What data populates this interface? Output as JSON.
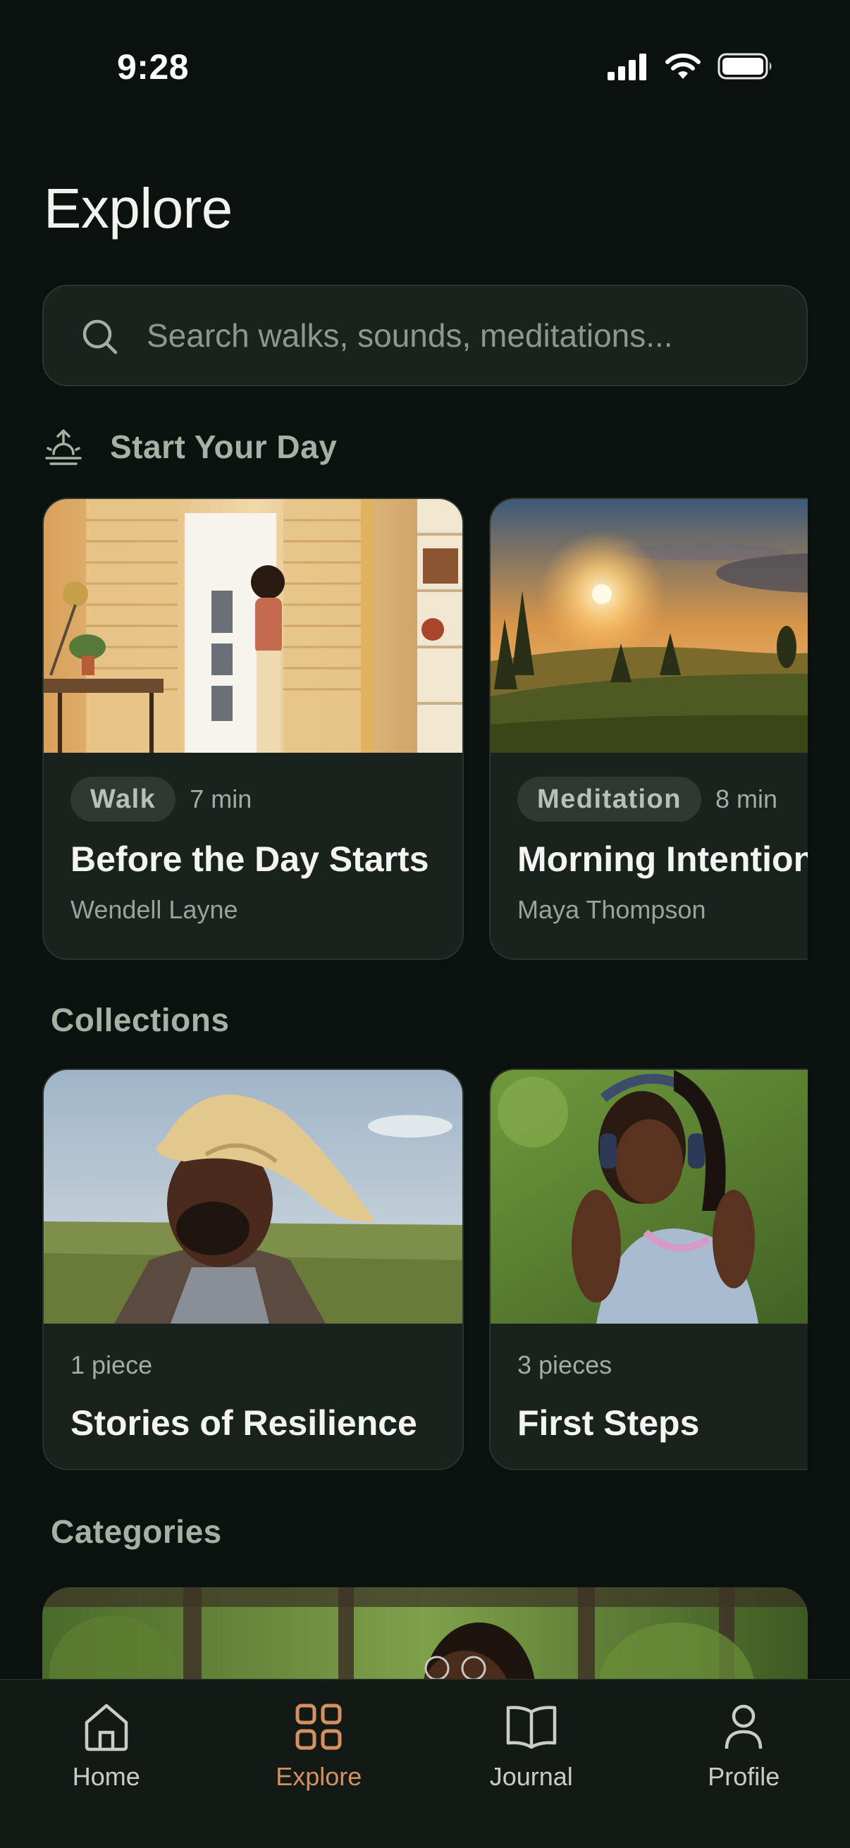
{
  "status_bar": {
    "time": "9:28",
    "icons": [
      "cellular-signal-icon",
      "wifi-icon",
      "battery-icon"
    ]
  },
  "page": {
    "title": "Explore"
  },
  "search": {
    "placeholder": "Search walks, sounds, meditations...",
    "icon": "search-icon"
  },
  "start_your_day": {
    "icon": "sunrise-icon",
    "title": "Start Your Day",
    "cards": [
      {
        "tag": "Walk",
        "duration": "7 min",
        "title": "Before the Day Starts",
        "author": "Wendell Layne"
      },
      {
        "tag": "Meditation",
        "duration": "8 min",
        "title": "Morning Intentions",
        "author": "Maya Thompson"
      }
    ]
  },
  "collections": {
    "title": "Collections",
    "cards": [
      {
        "count": "1 piece",
        "title": "Stories of Resilience"
      },
      {
        "count": "3 pieces",
        "title": "First Steps"
      }
    ]
  },
  "categories": {
    "title": "Categories"
  },
  "tab_bar": {
    "tabs": [
      {
        "label": "Home",
        "icon": "home-icon"
      },
      {
        "label": "Explore",
        "icon": "grid-icon"
      },
      {
        "label": "Journal",
        "icon": "book-icon"
      },
      {
        "label": "Profile",
        "icon": "person-icon"
      }
    ],
    "active": "Explore"
  },
  "colors": {
    "background": "#0b110e",
    "card": "#1a221e",
    "accent": "#d4915f",
    "muted_text": "#a8b0a6"
  }
}
